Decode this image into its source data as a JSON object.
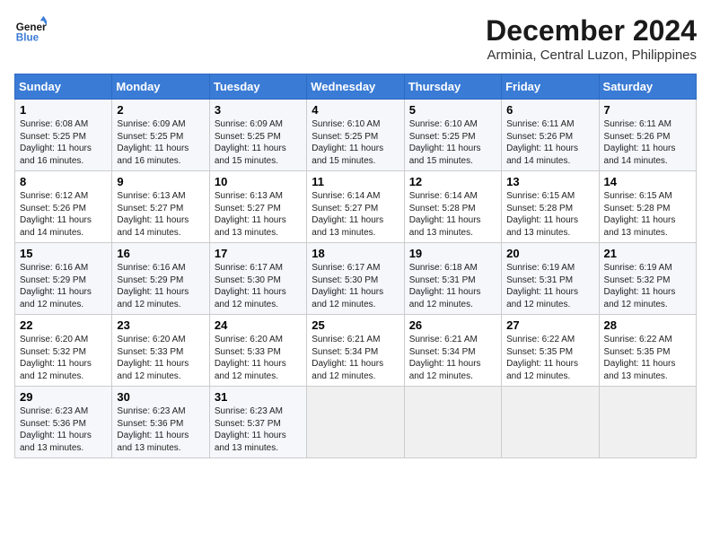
{
  "logo": {
    "line1": "General",
    "line2": "Blue"
  },
  "title": "December 2024",
  "location": "Arminia, Central Luzon, Philippines",
  "days_of_week": [
    "Sunday",
    "Monday",
    "Tuesday",
    "Wednesday",
    "Thursday",
    "Friday",
    "Saturday"
  ],
  "weeks": [
    [
      {
        "day": "1",
        "sunrise": "6:08 AM",
        "sunset": "5:25 PM",
        "daylight": "11 hours and 16 minutes."
      },
      {
        "day": "2",
        "sunrise": "6:09 AM",
        "sunset": "5:25 PM",
        "daylight": "11 hours and 16 minutes."
      },
      {
        "day": "3",
        "sunrise": "6:09 AM",
        "sunset": "5:25 PM",
        "daylight": "11 hours and 15 minutes."
      },
      {
        "day": "4",
        "sunrise": "6:10 AM",
        "sunset": "5:25 PM",
        "daylight": "11 hours and 15 minutes."
      },
      {
        "day": "5",
        "sunrise": "6:10 AM",
        "sunset": "5:25 PM",
        "daylight": "11 hours and 15 minutes."
      },
      {
        "day": "6",
        "sunrise": "6:11 AM",
        "sunset": "5:26 PM",
        "daylight": "11 hours and 14 minutes."
      },
      {
        "day": "7",
        "sunrise": "6:11 AM",
        "sunset": "5:26 PM",
        "daylight": "11 hours and 14 minutes."
      }
    ],
    [
      {
        "day": "8",
        "sunrise": "6:12 AM",
        "sunset": "5:26 PM",
        "daylight": "11 hours and 14 minutes."
      },
      {
        "day": "9",
        "sunrise": "6:13 AM",
        "sunset": "5:27 PM",
        "daylight": "11 hours and 14 minutes."
      },
      {
        "day": "10",
        "sunrise": "6:13 AM",
        "sunset": "5:27 PM",
        "daylight": "11 hours and 13 minutes."
      },
      {
        "day": "11",
        "sunrise": "6:14 AM",
        "sunset": "5:27 PM",
        "daylight": "11 hours and 13 minutes."
      },
      {
        "day": "12",
        "sunrise": "6:14 AM",
        "sunset": "5:28 PM",
        "daylight": "11 hours and 13 minutes."
      },
      {
        "day": "13",
        "sunrise": "6:15 AM",
        "sunset": "5:28 PM",
        "daylight": "11 hours and 13 minutes."
      },
      {
        "day": "14",
        "sunrise": "6:15 AM",
        "sunset": "5:28 PM",
        "daylight": "11 hours and 13 minutes."
      }
    ],
    [
      {
        "day": "15",
        "sunrise": "6:16 AM",
        "sunset": "5:29 PM",
        "daylight": "11 hours and 12 minutes."
      },
      {
        "day": "16",
        "sunrise": "6:16 AM",
        "sunset": "5:29 PM",
        "daylight": "11 hours and 12 minutes."
      },
      {
        "day": "17",
        "sunrise": "6:17 AM",
        "sunset": "5:30 PM",
        "daylight": "11 hours and 12 minutes."
      },
      {
        "day": "18",
        "sunrise": "6:17 AM",
        "sunset": "5:30 PM",
        "daylight": "11 hours and 12 minutes."
      },
      {
        "day": "19",
        "sunrise": "6:18 AM",
        "sunset": "5:31 PM",
        "daylight": "11 hours and 12 minutes."
      },
      {
        "day": "20",
        "sunrise": "6:19 AM",
        "sunset": "5:31 PM",
        "daylight": "11 hours and 12 minutes."
      },
      {
        "day": "21",
        "sunrise": "6:19 AM",
        "sunset": "5:32 PM",
        "daylight": "11 hours and 12 minutes."
      }
    ],
    [
      {
        "day": "22",
        "sunrise": "6:20 AM",
        "sunset": "5:32 PM",
        "daylight": "11 hours and 12 minutes."
      },
      {
        "day": "23",
        "sunrise": "6:20 AM",
        "sunset": "5:33 PM",
        "daylight": "11 hours and 12 minutes."
      },
      {
        "day": "24",
        "sunrise": "6:20 AM",
        "sunset": "5:33 PM",
        "daylight": "11 hours and 12 minutes."
      },
      {
        "day": "25",
        "sunrise": "6:21 AM",
        "sunset": "5:34 PM",
        "daylight": "11 hours and 12 minutes."
      },
      {
        "day": "26",
        "sunrise": "6:21 AM",
        "sunset": "5:34 PM",
        "daylight": "11 hours and 12 minutes."
      },
      {
        "day": "27",
        "sunrise": "6:22 AM",
        "sunset": "5:35 PM",
        "daylight": "11 hours and 12 minutes."
      },
      {
        "day": "28",
        "sunrise": "6:22 AM",
        "sunset": "5:35 PM",
        "daylight": "11 hours and 13 minutes."
      }
    ],
    [
      {
        "day": "29",
        "sunrise": "6:23 AM",
        "sunset": "5:36 PM",
        "daylight": "11 hours and 13 minutes."
      },
      {
        "day": "30",
        "sunrise": "6:23 AM",
        "sunset": "5:36 PM",
        "daylight": "11 hours and 13 minutes."
      },
      {
        "day": "31",
        "sunrise": "6:23 AM",
        "sunset": "5:37 PM",
        "daylight": "11 hours and 13 minutes."
      },
      null,
      null,
      null,
      null
    ]
  ],
  "labels": {
    "sunrise": "Sunrise:",
    "sunset": "Sunset:",
    "daylight": "Daylight:"
  }
}
